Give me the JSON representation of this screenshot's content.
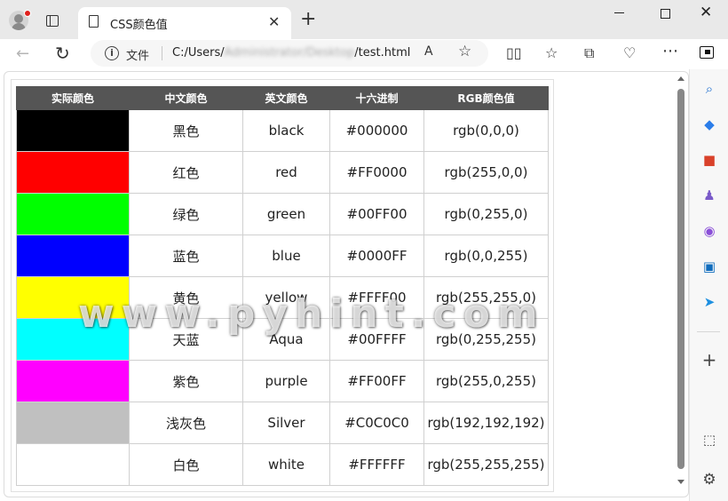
{
  "browser": {
    "tab_title": "CSS颜色值",
    "tab_close": "✕",
    "new_tab": "+",
    "window_close": "✕"
  },
  "toolbar": {
    "back": "←",
    "refresh": "↻",
    "info": "i",
    "file_label": "文件",
    "url_prefix": "C:/Users/",
    "url_blurred": "Administrator/Desktop",
    "url_suffix": "/test.html",
    "read_aloud": "A",
    "favorite": "☆"
  },
  "table": {
    "headers": [
      "实际颜色",
      "中文颜色",
      "英文颜色",
      "十六进制",
      "RGB颜色值"
    ],
    "rows": [
      {
        "swatch": "#000000",
        "cn": "黑色",
        "en": "black",
        "hex": "#000000",
        "rgb": "rgb(0,0,0)"
      },
      {
        "swatch": "#FF0000",
        "cn": "红色",
        "en": "red",
        "hex": "#FF0000",
        "rgb": "rgb(255,0,0)"
      },
      {
        "swatch": "#00FF00",
        "cn": "绿色",
        "en": "green",
        "hex": "#00FF00",
        "rgb": "rgb(0,255,0)"
      },
      {
        "swatch": "#0000FF",
        "cn": "蓝色",
        "en": "blue",
        "hex": "#0000FF",
        "rgb": "rgb(0,0,255)"
      },
      {
        "swatch": "#FFFF00",
        "cn": "黄色",
        "en": "yellow",
        "hex": "#FFFF00",
        "rgb": "rgb(255,255,0)"
      },
      {
        "swatch": "#00FFFF",
        "cn": "天蓝",
        "en": "Aqua",
        "hex": "#00FFFF",
        "rgb": "rgb(0,255,255)"
      },
      {
        "swatch": "#FF00FF",
        "cn": "紫色",
        "en": "purple",
        "hex": "#FF00FF",
        "rgb": "rgb(255,0,255)"
      },
      {
        "swatch": "#C0C0C0",
        "cn": "浅灰色",
        "en": "Silver",
        "hex": "#C0C0C0",
        "rgb": "rgb(192,192,192)"
      },
      {
        "swatch": "#FFFFFF",
        "cn": "白色",
        "en": "white",
        "hex": "#FFFFFF",
        "rgb": "rgb(255,255,255)"
      }
    ]
  },
  "watermark": "www.pyhint.com",
  "sidebar": {
    "icons": [
      "search-icon",
      "tag-icon",
      "toolbox-icon",
      "games-icon",
      "office-icon",
      "outlook-icon",
      "send-icon",
      "add-icon",
      "screenshot-icon",
      "settings-icon"
    ],
    "add": "+",
    "settings": "⚙"
  },
  "colors": {
    "table_header_bg": "#555555",
    "titlebar_bg": "#e9e9e9",
    "tab_bg": "#ffffff"
  }
}
